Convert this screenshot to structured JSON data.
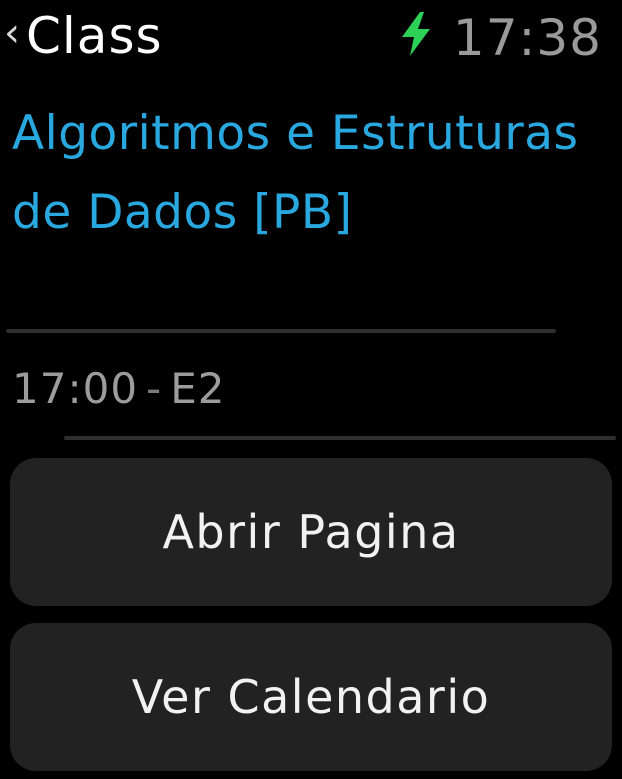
{
  "status_bar": {
    "back_label": "Class",
    "back_icon": "chevron-left-icon",
    "charging_icon": "lightning-bolt-icon",
    "time": "17:38"
  },
  "class": {
    "title": "Algoritmos e Estruturas de Dados [PB]",
    "time": "17:00",
    "separator": "-",
    "room": "E2"
  },
  "actions": {
    "open_page_label": "Abrir Pagina",
    "view_calendar_label": "Ver Calendario"
  },
  "colors": {
    "accent": "#29a8e0",
    "charging": "#2ed158",
    "background": "#000000",
    "button_bg": "#222222"
  }
}
